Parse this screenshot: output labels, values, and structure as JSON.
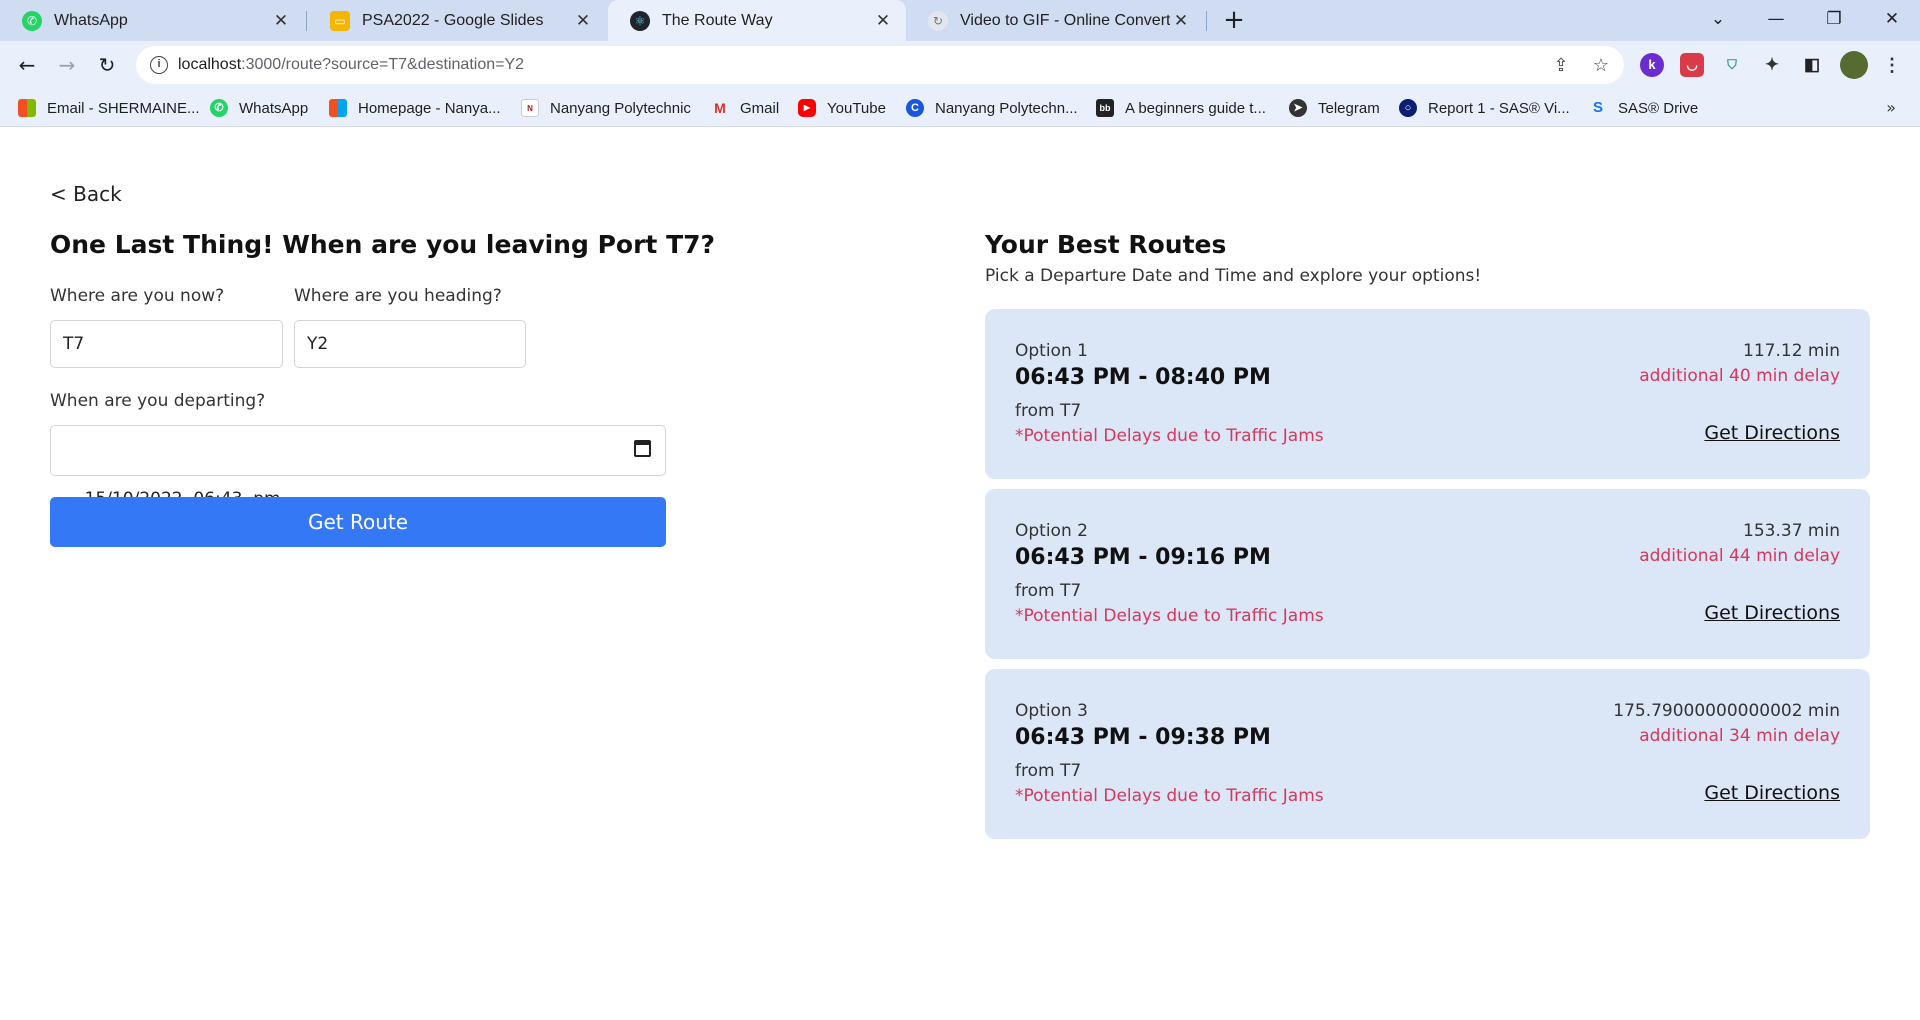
{
  "browser": {
    "tabs": [
      {
        "title": "WhatsApp",
        "favicon": "whatsapp-icon",
        "active": false
      },
      {
        "title": "PSA2022 - Google Slides",
        "favicon": "slides-icon",
        "active": false
      },
      {
        "title": "The Route Way",
        "favicon": "react-icon",
        "active": true
      },
      {
        "title": "Video to GIF - Online Converter",
        "favicon": "converter-icon",
        "active": false
      }
    ],
    "tab_close": "✕",
    "new_tab": "+",
    "url_host": "localhost",
    "url_rest": ":3000/route?source=T7&destination=Y2",
    "bookmarks": [
      {
        "label": "Email - SHERMAINE...",
        "icon": "microsoft-icon"
      },
      {
        "label": "WhatsApp",
        "icon": "whatsapp-icon"
      },
      {
        "label": "Homepage - Nanya...",
        "icon": "microsoft-icon"
      },
      {
        "label": "Nanyang Polytechnic",
        "icon": "nyp-icon"
      },
      {
        "label": "Gmail",
        "icon": "gmail-icon"
      },
      {
        "label": "YouTube",
        "icon": "youtube-icon"
      },
      {
        "label": "Nanyang Polytechn...",
        "icon": "c-icon"
      },
      {
        "label": "A beginners guide t...",
        "icon": "bb-icon"
      },
      {
        "label": "Telegram",
        "icon": "telegram-icon"
      },
      {
        "label": "Report 1 - SAS® Vi...",
        "icon": "sas-icon"
      },
      {
        "label": "SAS® Drive",
        "icon": "sas-drive-icon"
      }
    ],
    "bookmarks_more": "»"
  },
  "form": {
    "back": "< Back",
    "heading": "One Last Thing! When are you leaving Port T7?",
    "source_label": "Where are you now?",
    "source_value": "T7",
    "dest_label": "Where are you heading?",
    "dest_value": "Y2",
    "depart_label": "When are you departing?",
    "depart_value": "15/10/2022  06:43  pm",
    "submit": "Get Route"
  },
  "routes": {
    "title": "Your Best Routes",
    "subtitle": "Pick a Departure Date and Time and explore your options!",
    "options": [
      {
        "option": "Option 1",
        "time": "06:43 PM - 08:40 PM",
        "from": "from T7",
        "warning": "*Potential Delays due to Traffic Jams",
        "duration": "117.12 min",
        "delay": "additional 40 min delay",
        "action": "Get Directions"
      },
      {
        "option": "Option 2",
        "time": "06:43 PM - 09:16 PM",
        "from": "from T7",
        "warning": "*Potential Delays due to Traffic Jams",
        "duration": "153.37 min",
        "delay": "additional 44 min delay",
        "action": "Get Directions"
      },
      {
        "option": "Option 3",
        "time": "06:43 PM - 09:38 PM",
        "from": "from T7",
        "warning": "*Potential Delays due to Traffic Jams",
        "duration": "175.79000000000002 min",
        "delay": "additional 34 min delay",
        "action": "Get Directions"
      }
    ]
  },
  "colors": {
    "accent": "#3478f6",
    "card_bg": "#dbe6f7",
    "warning": "#d4385c",
    "tabstrip": "#cfdcf2",
    "toolbar": "#eaf0fb"
  }
}
